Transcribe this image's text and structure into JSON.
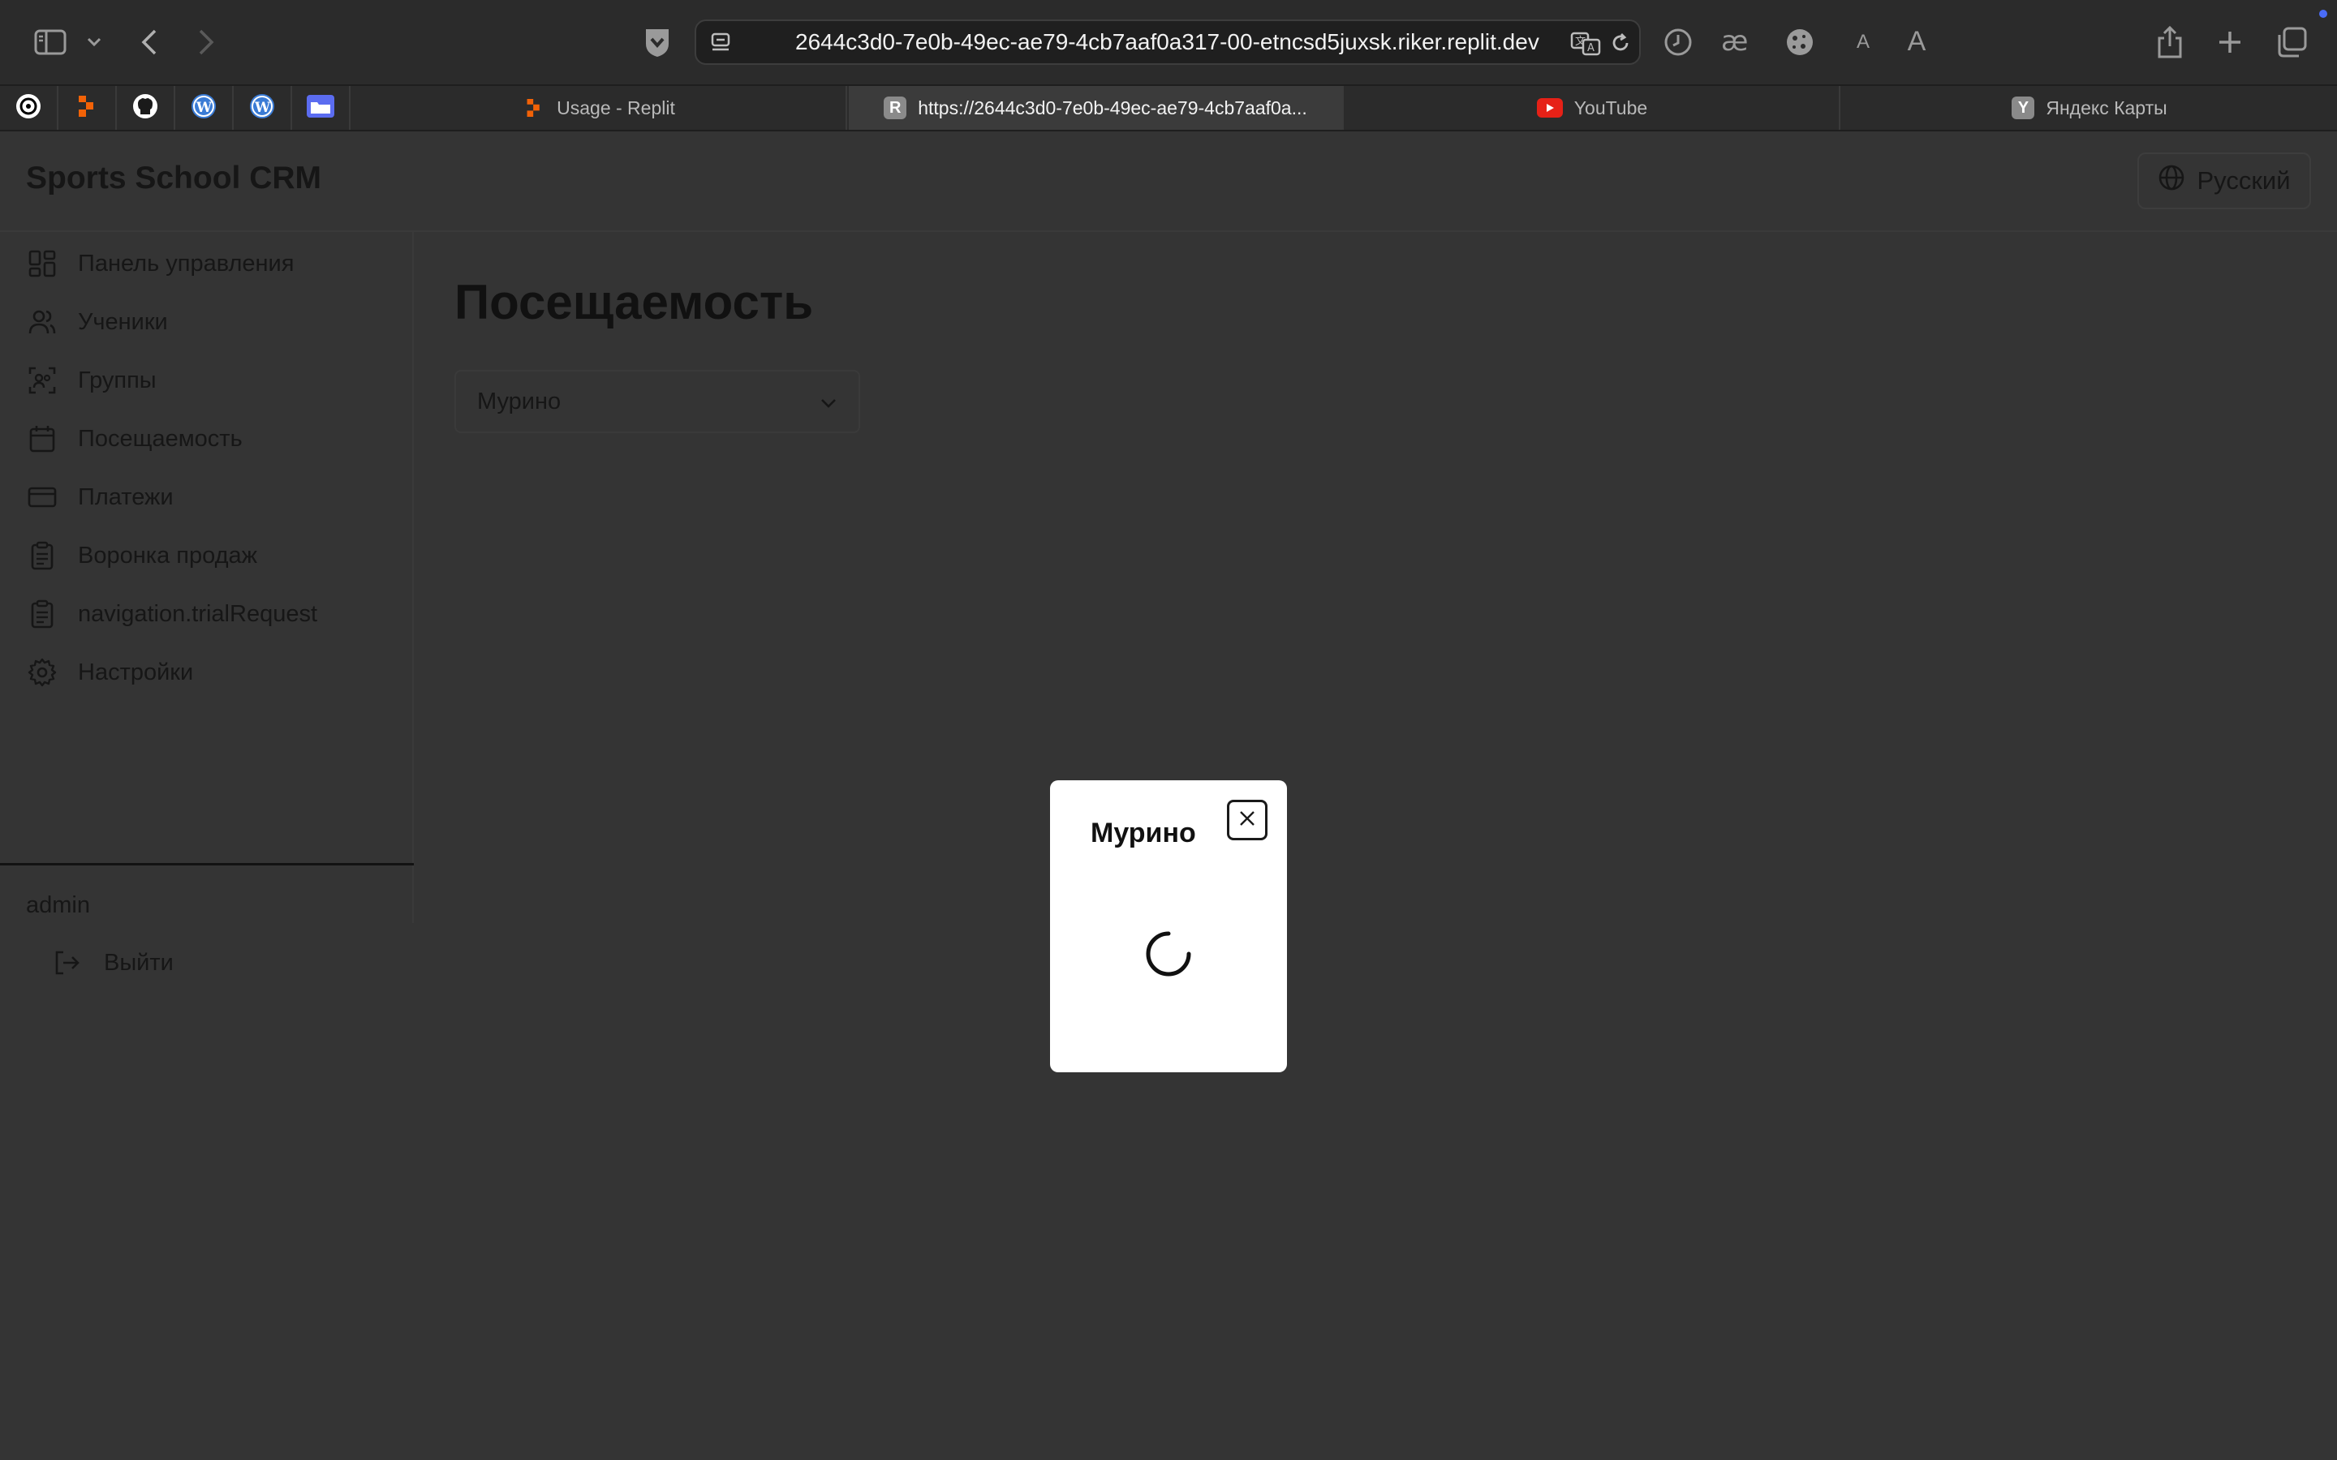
{
  "browser": {
    "url": "2644c3d0-7e0b-49ec-ae79-4cb7aaf0a317-00-etncsd5juxsk.riker.replit.dev",
    "reader_small": "A",
    "reader_large": "A",
    "tabs": [
      {
        "label": "Usage - Replit",
        "favicon": "replit-favicon",
        "active": false
      },
      {
        "label": "https://2644c3d0-7e0b-49ec-ae79-4cb7aaf0a...",
        "favicon": "R",
        "active": true
      },
      {
        "label": "YouTube",
        "favicon": "youtube-favicon",
        "active": false
      },
      {
        "label": "Яндекс Карты",
        "favicon": "Y",
        "active": false
      }
    ],
    "pinned": [
      "openai-icon",
      "replit-icon",
      "github-icon",
      "wordpress-icon",
      "wordpress-icon",
      "folder-icon"
    ]
  },
  "app": {
    "brand": "Sports School CRM",
    "language": "Русский",
    "nav": [
      {
        "label": "Панель управления",
        "icon": "dashboard-icon"
      },
      {
        "label": "Ученики",
        "icon": "users-icon"
      },
      {
        "label": "Группы",
        "icon": "groups-icon"
      },
      {
        "label": "Посещаемость",
        "icon": "calendar-icon"
      },
      {
        "label": "Платежи",
        "icon": "card-icon"
      },
      {
        "label": "Воронка продаж",
        "icon": "clipboard-icon"
      },
      {
        "label": "navigation.trialRequest",
        "icon": "clipboard-icon"
      },
      {
        "label": "Настройки",
        "icon": "gear-icon"
      }
    ],
    "user": "admin",
    "logout": "Выйти",
    "page_title": "Посещаемость",
    "location_select": "Мурино"
  },
  "modal": {
    "title": "Мурино"
  },
  "colors": {
    "overlay_bg": "#343434",
    "chrome_bg": "#2b2b2b",
    "modal_bg": "#ffffff"
  }
}
